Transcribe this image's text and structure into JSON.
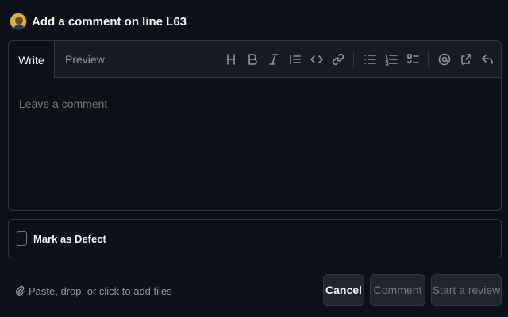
{
  "header": {
    "avatar_icon": "user-avatar",
    "title": "Add a comment on line L63"
  },
  "editor": {
    "tabs": [
      {
        "label": "Write",
        "active": true
      },
      {
        "label": "Preview",
        "active": false
      }
    ],
    "toolbar": [
      {
        "name": "heading",
        "icon": "heading-icon"
      },
      {
        "name": "bold",
        "icon": "bold-icon"
      },
      {
        "name": "italic",
        "icon": "italic-icon"
      },
      {
        "name": "quote",
        "icon": "quote-icon"
      },
      {
        "name": "code",
        "icon": "code-icon"
      },
      {
        "name": "link",
        "icon": "link-icon"
      },
      {
        "name": "unordered-list",
        "icon": "unordered-list-icon"
      },
      {
        "name": "ordered-list",
        "icon": "ordered-list-icon"
      },
      {
        "name": "task-list",
        "icon": "task-list-icon"
      },
      {
        "name": "mention",
        "icon": "mention-icon"
      },
      {
        "name": "reference",
        "icon": "cross-reference-icon"
      },
      {
        "name": "reply",
        "icon": "reply-icon"
      }
    ],
    "textarea": {
      "placeholder": "Leave a comment",
      "value": ""
    }
  },
  "defect": {
    "checked": false,
    "label": "Mark as Defect"
  },
  "footer": {
    "attach_icon": "paperclip-icon",
    "attach_text": "Paste, drop, or click to add files"
  },
  "buttons": {
    "cancel": "Cancel",
    "comment": "Comment",
    "review": "Start a review"
  },
  "colors": {
    "background": "#0d1117",
    "border": "#30363d",
    "muted_text": "#8b949e",
    "text": "#f0f6fc"
  }
}
